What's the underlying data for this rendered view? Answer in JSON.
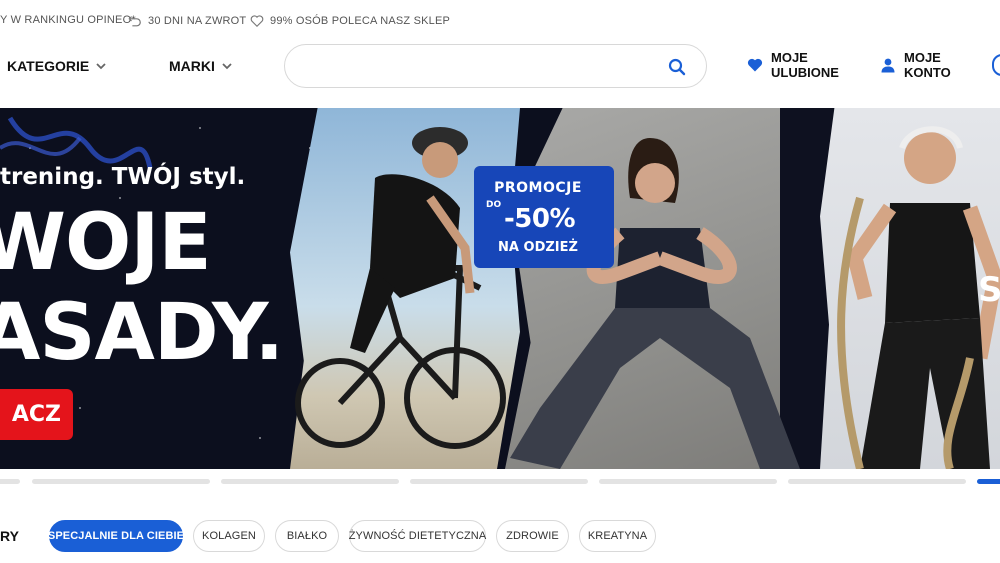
{
  "topbar": {
    "ranking": "Y W RANKINGU OPINEO*",
    "returns": "30 DNI NA ZWROT",
    "recommend": "99% OSÓB POLECA NASZ SKLEP"
  },
  "nav": {
    "categories": "KATEGORIE",
    "brands": "MARKI",
    "search_placeholder": "",
    "favorites_line1": "MOJE",
    "favorites_line2": "ULUBIONE",
    "account_line1": "MOJE",
    "account_line2": "KONTO"
  },
  "hero": {
    "tagline": "trening. TWÓJ styl.",
    "headline_1": "WOJE",
    "headline_2": "ASADY.",
    "cta": "ACZ",
    "promo_title": "PROMOCJE",
    "promo_do": "DO",
    "promo_value": "-50%",
    "promo_sub": "NA ODZIEŻ",
    "right_letter": "S"
  },
  "slider": {
    "total": 6,
    "active_index": 5
  },
  "chips": {
    "heading": "RY",
    "items": [
      {
        "label": "SPECJALNIE DLA CIEBIE",
        "active": true
      },
      {
        "label": "KOLAGEN",
        "active": false
      },
      {
        "label": "BIAŁKO",
        "active": false
      },
      {
        "label": "ŻYWNOŚĆ DIETETYCZNA",
        "active": false
      },
      {
        "label": "ZDROWIE",
        "active": false
      },
      {
        "label": "KREATYNA",
        "active": false
      }
    ]
  },
  "colors": {
    "accent": "#1a5fd6",
    "cta_red": "#e4141b",
    "promo_blue": "#1746b8"
  }
}
